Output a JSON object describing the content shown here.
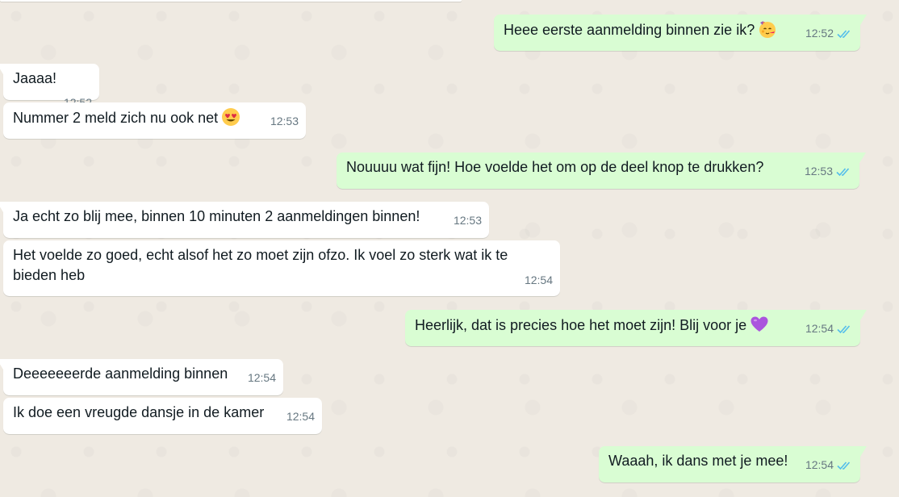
{
  "conversation": {
    "messages": [
      {
        "direction": "out",
        "text": "Heee eerste aanmelding binnen zie ik?",
        "emoji": "party-face",
        "time": "12:52",
        "status": "read"
      },
      {
        "direction": "in",
        "text": "Jaaaa!",
        "time": "12:52"
      },
      {
        "direction": "in",
        "text": "Nummer 2 meld zich nu ook net",
        "emoji": "heart-eyes",
        "time": "12:53"
      },
      {
        "direction": "out",
        "text": "Nouuuu wat fijn! Hoe voelde het om op de deel knop te drukken?",
        "time": "12:53",
        "status": "read"
      },
      {
        "direction": "in",
        "text": "Ja echt zo blij mee, binnen 10 minuten 2 aanmeldingen binnen!",
        "time": "12:53"
      },
      {
        "direction": "in",
        "text": "Het voelde zo goed, echt alsof het zo moet zijn ofzo. Ik voel zo sterk wat ik te bieden heb",
        "time": "12:54"
      },
      {
        "direction": "out",
        "text": "Heerlijk, dat is precies hoe het moet zijn! Blij voor je",
        "emoji": "purple-heart",
        "time": "12:54",
        "status": "read"
      },
      {
        "direction": "in",
        "text": "Deeeeeeerde aanmelding binnen",
        "time": "12:54"
      },
      {
        "direction": "in",
        "text": "Ik doe een vreugde dansje in de kamer",
        "time": "12:54"
      },
      {
        "direction": "out",
        "text": "Waaah, ik dans met je mee!",
        "time": "12:54",
        "status": "read"
      }
    ]
  },
  "colors": {
    "background": "#efeae2",
    "incoming_bubble": "#ffffff",
    "outgoing_bubble": "#d9fdd3",
    "text": "#111b21",
    "meta_text": "#667781",
    "read_ticks": "#53bdeb"
  }
}
